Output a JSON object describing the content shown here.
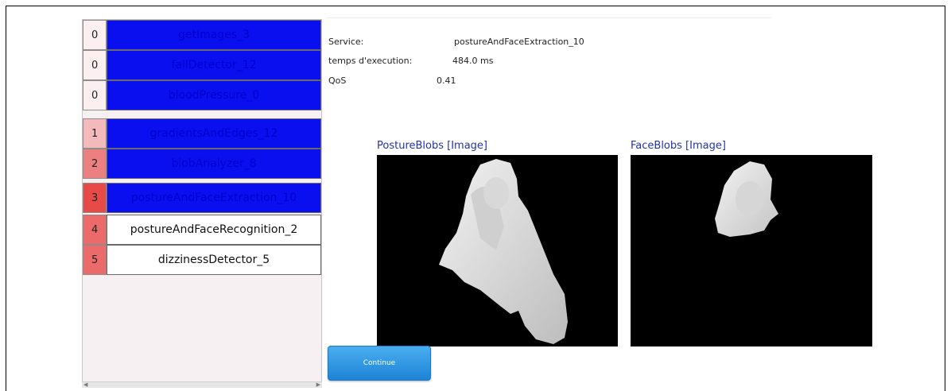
{
  "services": [
    {
      "level": "0",
      "name": "getImages_3",
      "state": "done",
      "level_color": "#fbeff0"
    },
    {
      "level": "0",
      "name": "fallDetector_12",
      "state": "done",
      "level_color": "#fbeff0"
    },
    {
      "level": "0",
      "name": "bloodPressure_0",
      "state": "done",
      "level_color": "#fbeff0"
    },
    {
      "level": "1",
      "name": "gradientsAndEdges_12",
      "state": "done",
      "level_color": "#f4b9bb"
    },
    {
      "level": "2",
      "name": "blobAnalyzer_8",
      "state": "done",
      "level_color": "#ec7f80"
    },
    {
      "level": "3",
      "name": "postureAndFaceExtraction_10",
      "state": "done",
      "level_color": "#e74a47"
    },
    {
      "level": "4",
      "name": "postureAndFaceRecognition_2",
      "state": "todo",
      "level_color": "#ec6a6a"
    },
    {
      "level": "5",
      "name": "dizzinessDetector_5",
      "state": "todo",
      "level_color": "#ec6a6a"
    }
  ],
  "info": {
    "service_label": "Service:",
    "service_value": "postureAndFaceExtraction_10",
    "time_label": "temps d'execution:",
    "time_value": "484.0 ms",
    "qos_label": "QoS",
    "qos_value": "0.41"
  },
  "images": {
    "posture_title": "PostureBlobs [Image]",
    "face_title": "FaceBlobs [Image]"
  },
  "continue_label": "Continue",
  "colors": {
    "done": "#0a0ff0",
    "accent": "#2233aa",
    "button": "#1f84d6"
  }
}
